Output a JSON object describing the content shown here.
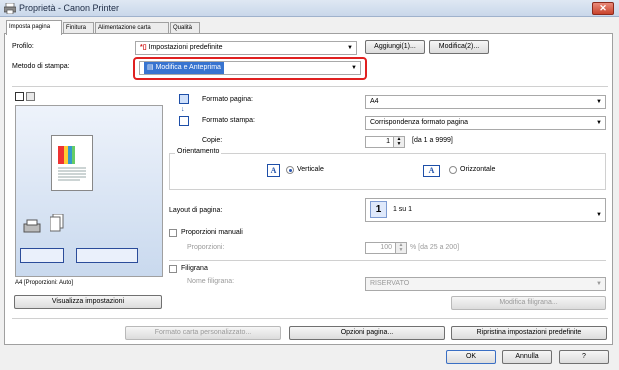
{
  "window": {
    "title": "Proprietà - Canon Printer",
    "close_label": "✕"
  },
  "tabs": [
    "Imposta pagina",
    "Finitura",
    "Alimentazione carta",
    "Qualità"
  ],
  "profile": {
    "label": "Profilo:",
    "value": "Impostazioni predefinite",
    "add_button": "Aggiungi(1)...",
    "edit_button": "Modifica(2)..."
  },
  "print_method": {
    "label": "Metodo di stampa:",
    "value": "Modifica e Anteprima"
  },
  "preview": {
    "caption": "A4 [Proporzioni: Auto]",
    "view_settings_button": "Visualizza impostazioni"
  },
  "page_size": {
    "label": "Formato pagina:",
    "value": "A4"
  },
  "output_size": {
    "label": "Formato stampa:",
    "value": "Corrispondenza formato pagina"
  },
  "copies": {
    "label": "Copie:",
    "value": "1",
    "range": "[da 1 a 9999]"
  },
  "orientation": {
    "label": "Orientamento",
    "portrait": "Verticale",
    "landscape": "Orizzontale",
    "portrait_selected": true
  },
  "layout": {
    "label": "Layout di pagina:",
    "value": "1 su 1",
    "badge": "1"
  },
  "manual_scaling": {
    "label": "Proporzioni manuali",
    "scale_label": "Proporzioni:",
    "scale_value": "100",
    "scale_range": "% [da 25 a 200]"
  },
  "watermark": {
    "label": "Filigrana",
    "name_label": "Nome filigrana:",
    "name_value": "RISERVATO",
    "edit_button": "Modifica filigrana..."
  },
  "bottom_buttons": {
    "custom_paper": "Formato carta personalizzato...",
    "page_options": "Opzioni pagina...",
    "restore_defaults": "Ripristina impostazioni predefinite"
  },
  "dialog_buttons": {
    "ok": "OK",
    "cancel": "Annulla",
    "help": "?"
  },
  "colors": {
    "highlight": "#3874d0",
    "focus_ring": "#e02020"
  }
}
